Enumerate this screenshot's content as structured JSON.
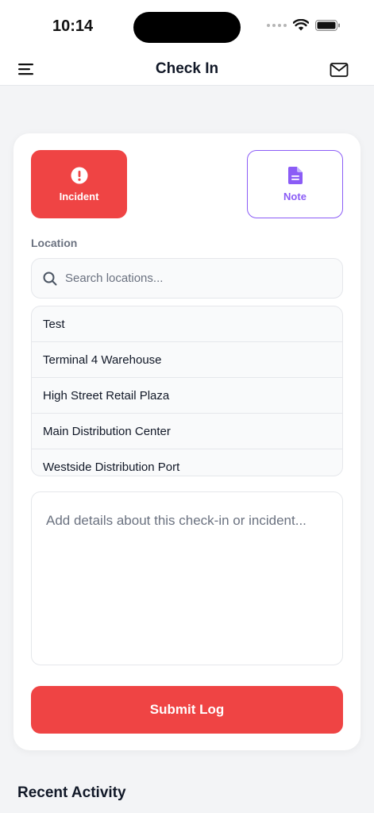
{
  "status_bar": {
    "time": "10:14"
  },
  "nav": {
    "title": "Check In"
  },
  "entry_types": {
    "incident_label": "Incident",
    "note_label": "Note"
  },
  "location": {
    "label": "Location",
    "search_placeholder": "Search locations...",
    "items": [
      "Test",
      "Terminal 4 Warehouse",
      "High Street Retail Plaza",
      "Main Distribution Center",
      "Westside Distribution Port"
    ]
  },
  "details": {
    "placeholder": "Add details about this check-in or incident..."
  },
  "submit_label": "Submit Log",
  "recent_activity_title": "Recent Activity",
  "colors": {
    "incident_red": "#ef4444",
    "note_purple": "#8b5cf6",
    "background": "#f3f4f6"
  },
  "icons": {
    "menu": "hamburger-menu-icon",
    "mail": "mail-icon",
    "incident": "exclamation-circle-icon",
    "note": "document-icon",
    "search": "search-icon"
  }
}
